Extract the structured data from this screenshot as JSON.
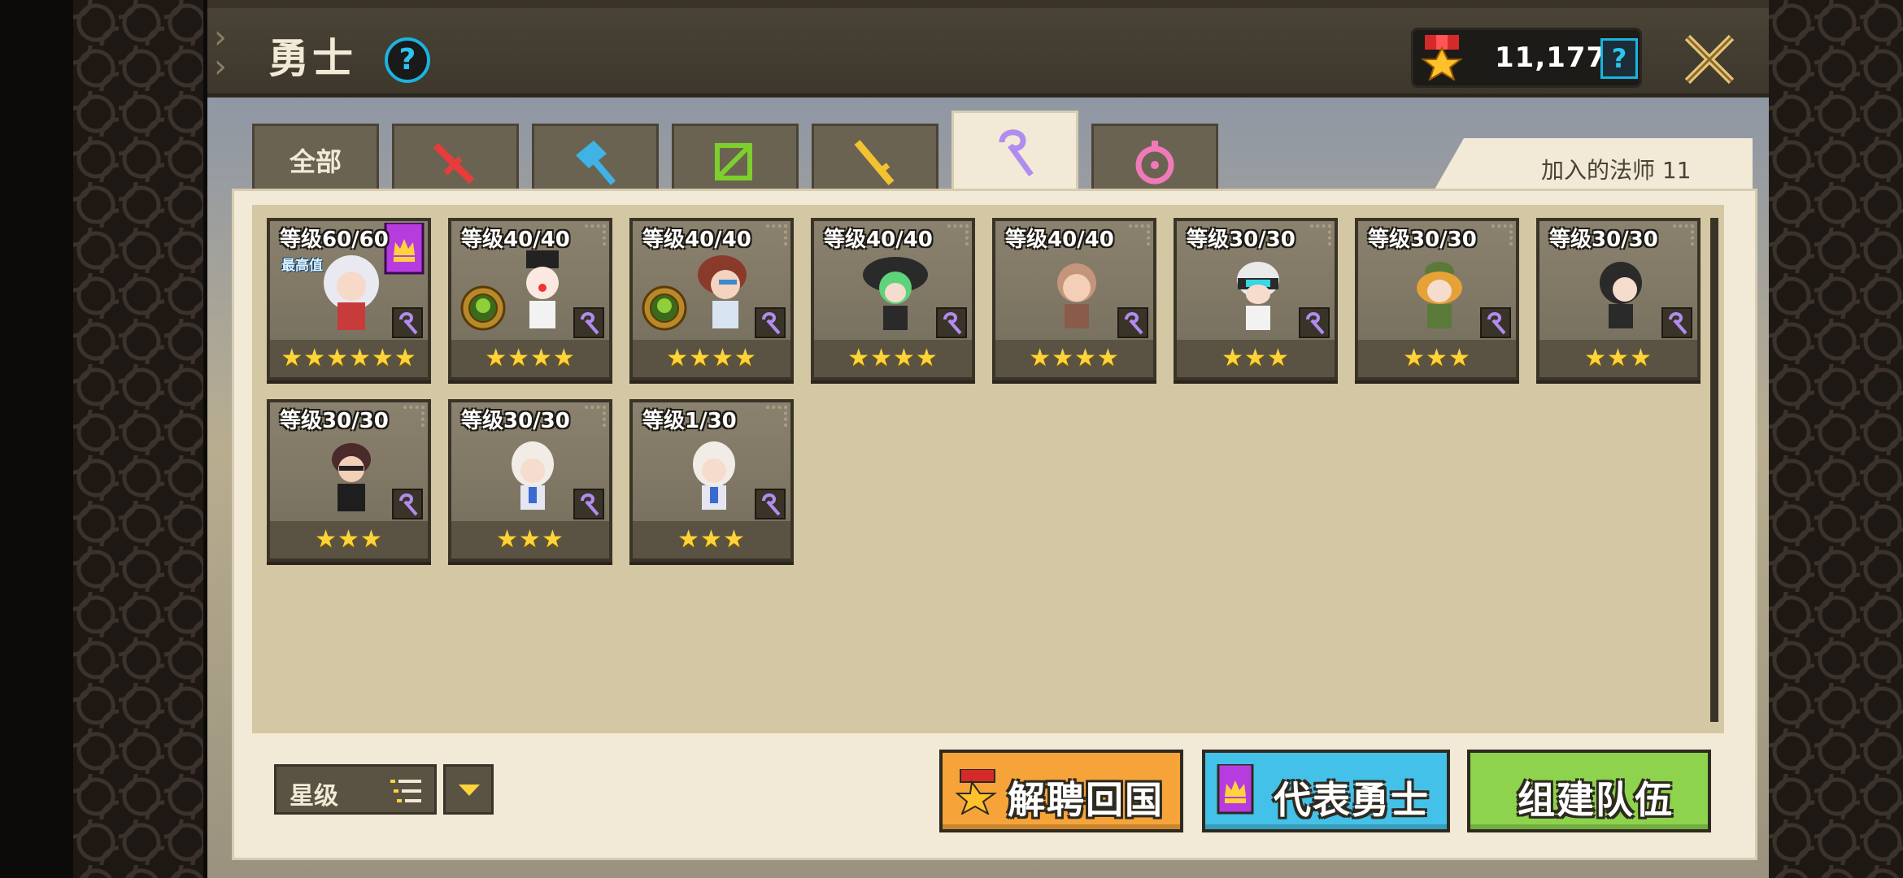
{
  "header": {
    "title": "勇士",
    "help_symbol": "?",
    "currency_value": "11,177",
    "currency_help_symbol": "?"
  },
  "tabs": [
    {
      "label": "全部",
      "icon": "all",
      "active": false
    },
    {
      "label": "",
      "icon": "sword-icon",
      "active": false
    },
    {
      "label": "",
      "icon": "hammer-icon",
      "active": false
    },
    {
      "label": "",
      "icon": "bow-icon",
      "active": false
    },
    {
      "label": "",
      "icon": "gun-icon",
      "active": false
    },
    {
      "label": "",
      "icon": "staff-icon",
      "active": true
    },
    {
      "label": "",
      "icon": "healer-icon",
      "active": false
    }
  ],
  "panel": {
    "joined_label": "加入的法师 11"
  },
  "heroes": [
    {
      "level": "等级60/60",
      "stars": "★★★★★★",
      "max_badge": "最高值",
      "representative": true,
      "ring": false
    },
    {
      "level": "等级40/40",
      "stars": "★★★★",
      "ring": true
    },
    {
      "level": "等级40/40",
      "stars": "★★★★",
      "ring": true
    },
    {
      "level": "等级40/40",
      "stars": "★★★★",
      "ring": false
    },
    {
      "level": "等级40/40",
      "stars": "★★★★",
      "ring": false
    },
    {
      "level": "等级30/30",
      "stars": "★★★",
      "ring": false
    },
    {
      "level": "等级30/30",
      "stars": "★★★",
      "ring": false
    },
    {
      "level": "等级30/30",
      "stars": "★★★",
      "ring": false
    },
    {
      "level": "等级30/30",
      "stars": "★★★",
      "ring": false
    },
    {
      "level": "等级30/30",
      "stars": "★★★",
      "ring": false
    },
    {
      "level": "等级1/30",
      "stars": "★★★",
      "ring": false
    }
  ],
  "sort": {
    "label": "星级"
  },
  "buttons": {
    "dismiss": "解聘回国",
    "representative": "代表勇士",
    "form_team": "组建队伍"
  },
  "colors": {
    "accent_orange": "#f6a43a",
    "accent_blue": "#44c1e8",
    "accent_green": "#8dd34d",
    "staff_purple": "#b18cf0",
    "star_gold": "#ffd43b"
  }
}
